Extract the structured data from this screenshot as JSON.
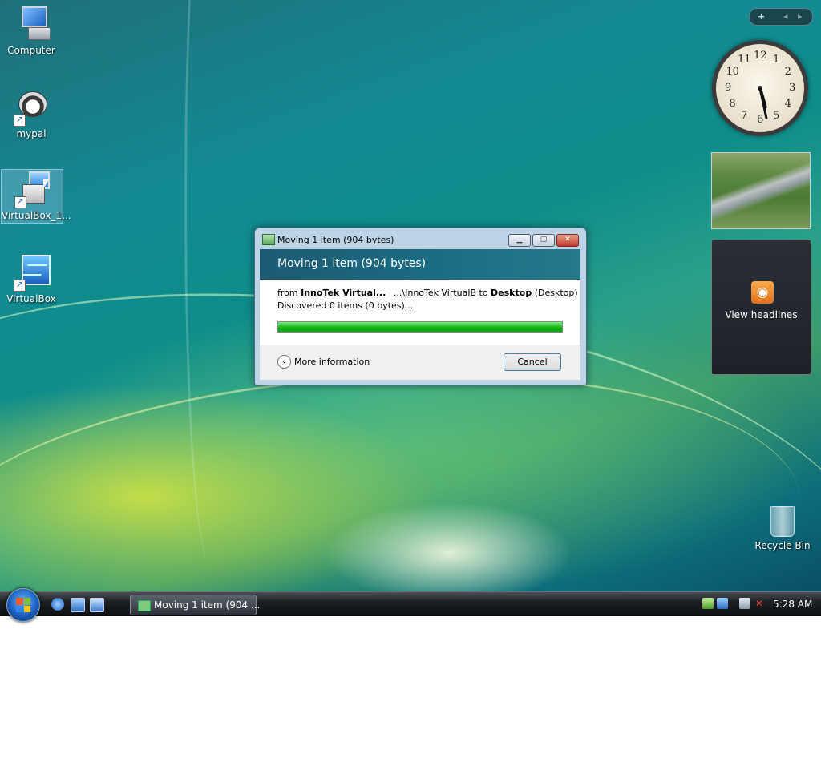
{
  "desktop": {
    "icons": [
      {
        "label": "Computer"
      },
      {
        "label": "mypal"
      },
      {
        "label": "VirtualBox_1..."
      },
      {
        "label": "VirtualBox"
      }
    ],
    "recycle_bin_label": "Recycle Bin"
  },
  "dialog": {
    "window_title": "Moving 1 item (904 bytes)",
    "heading": "Moving 1 item (904 bytes)",
    "from_prefix": "from",
    "from_name": "InnoTek Virtual...",
    "path": "...\\InnoTek VirtualB",
    "to_word": "to",
    "dest_name": "Desktop",
    "dest_paren": "(Desktop)",
    "discovered": "Discovered 0 items (0 bytes)...",
    "progress": 1.0,
    "more_info_label": "More information",
    "cancel_label": "Cancel",
    "window_buttons": {
      "minimize": "▁",
      "maximize": "▢",
      "close": "✕"
    }
  },
  "sidebar_gadgets": {
    "controls": {
      "add": "+",
      "prev": "◂",
      "next": "▸"
    },
    "clock_numbers": [
      "12",
      "1",
      "2",
      "3",
      "4",
      "5",
      "6",
      "7",
      "8",
      "9",
      "10",
      "11"
    ],
    "clock_time": {
      "hour": 5,
      "minute": 28
    },
    "feed_label": "View headlines"
  },
  "taskbar": {
    "task_label": "Moving 1 item (904 ...",
    "clock": "5:28 AM",
    "colors": {
      "accent": "#1b6e84",
      "progress": "#18b818"
    }
  }
}
